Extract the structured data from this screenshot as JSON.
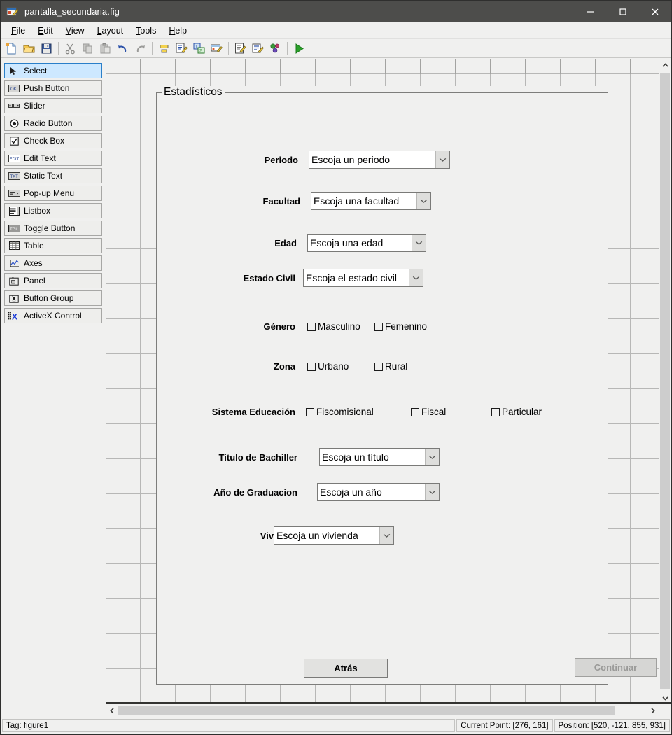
{
  "window": {
    "title": "pantalla_secundaria.fig",
    "icon": "guide-figure-icon",
    "minimize": "—",
    "maximize": "□",
    "close": "✕"
  },
  "menubar": {
    "items": [
      {
        "label": "File",
        "accel": "F"
      },
      {
        "label": "Edit",
        "accel": "E"
      },
      {
        "label": "View",
        "accel": "V"
      },
      {
        "label": "Layout",
        "accel": "L"
      },
      {
        "label": "Tools",
        "accel": "T"
      },
      {
        "label": "Help",
        "accel": "H"
      }
    ]
  },
  "toolbar": {
    "buttons": [
      {
        "name": "new-figure-icon",
        "tip": "New"
      },
      {
        "name": "open-figure-icon",
        "tip": "Open"
      },
      {
        "name": "save-figure-icon",
        "tip": "Save"
      },
      {
        "name": "cut-icon",
        "tip": "Cut"
      },
      {
        "name": "copy-icon",
        "tip": "Copy"
      },
      {
        "name": "paste-icon",
        "tip": "Paste"
      },
      {
        "name": "undo-icon",
        "tip": "Undo"
      },
      {
        "name": "redo-icon",
        "tip": "Redo"
      },
      {
        "name": "align-objects-icon",
        "tip": "Align Objects"
      },
      {
        "name": "menu-editor-icon",
        "tip": "Menu Editor"
      },
      {
        "name": "tab-order-editor-icon",
        "tip": "Tab Order Editor"
      },
      {
        "name": "toolbar-editor-icon",
        "tip": "Toolbar Editor"
      },
      {
        "name": "m-file-editor-icon",
        "tip": "M-file Editor"
      },
      {
        "name": "property-inspector-icon",
        "tip": "Property Inspector"
      },
      {
        "name": "object-browser-icon",
        "tip": "Object Browser"
      },
      {
        "name": "run-icon",
        "tip": "Run"
      }
    ]
  },
  "palette": {
    "items": [
      {
        "label": "Select",
        "icon": "arrow-cursor-icon",
        "selected": true
      },
      {
        "label": "Push Button",
        "icon": "push-button-icon",
        "selected": false
      },
      {
        "label": "Slider",
        "icon": "slider-icon",
        "selected": false
      },
      {
        "label": "Radio Button",
        "icon": "radio-button-icon",
        "selected": false
      },
      {
        "label": "Check Box",
        "icon": "check-box-icon",
        "selected": false
      },
      {
        "label": "Edit Text",
        "icon": "edit-text-icon",
        "selected": false
      },
      {
        "label": "Static Text",
        "icon": "static-text-icon",
        "selected": false
      },
      {
        "label": "Pop-up Menu",
        "icon": "popup-menu-icon",
        "selected": false
      },
      {
        "label": "Listbox",
        "icon": "listbox-icon",
        "selected": false
      },
      {
        "label": "Toggle Button",
        "icon": "toggle-button-icon",
        "selected": false
      },
      {
        "label": "Table",
        "icon": "table-icon",
        "selected": false
      },
      {
        "label": "Axes",
        "icon": "axes-icon",
        "selected": false
      },
      {
        "label": "Panel",
        "icon": "panel-icon",
        "selected": false
      },
      {
        "label": "Button Group",
        "icon": "button-group-icon",
        "selected": false
      },
      {
        "label": "ActiveX Control",
        "icon": "activex-icon",
        "selected": false
      }
    ]
  },
  "figure": {
    "panel_title": "Estadísticos",
    "fields": [
      {
        "label": "Periodo",
        "value": "Escoja un periodo"
      },
      {
        "label": "Facultad",
        "value": "Escoja una facultad"
      },
      {
        "label": "Edad",
        "value": "Escoja una edad"
      },
      {
        "label": "Estado Civil",
        "value": "Escoja el estado civil"
      },
      {
        "label": "Titulo de Bachiller",
        "value": "Escoja un título"
      },
      {
        "label": "Año de Graduacion",
        "value": "Escoja un año"
      },
      {
        "label": "Vivienda",
        "value": "Escoja un vivienda"
      }
    ],
    "checkbox_groups": [
      {
        "label": "Género",
        "options": [
          "Masculino",
          "Femenino"
        ]
      },
      {
        "label": "Zona",
        "options": [
          "Urbano",
          "Rural"
        ]
      },
      {
        "label": "Sistema Educación",
        "options": [
          "Fiscomisional",
          "Fiscal",
          "Particular"
        ]
      }
    ],
    "buttons": {
      "back": "Atrás",
      "continue": "Continuar"
    }
  },
  "statusbar": {
    "tag": "Tag: figure1",
    "current_point": "Current Point:  [276, 161]",
    "position": "Position: [520, -121, 855, 931]"
  },
  "colors": {
    "titlebar": "#4d4d4b",
    "app_background": "#f0f0ef",
    "selection_blue": "#cde8ff",
    "selection_border": "#2a7fc9",
    "scrollbar_thumb": "#cdcdcd",
    "grid_line": "#9a9a98",
    "run_green": "#1a8c1a"
  }
}
